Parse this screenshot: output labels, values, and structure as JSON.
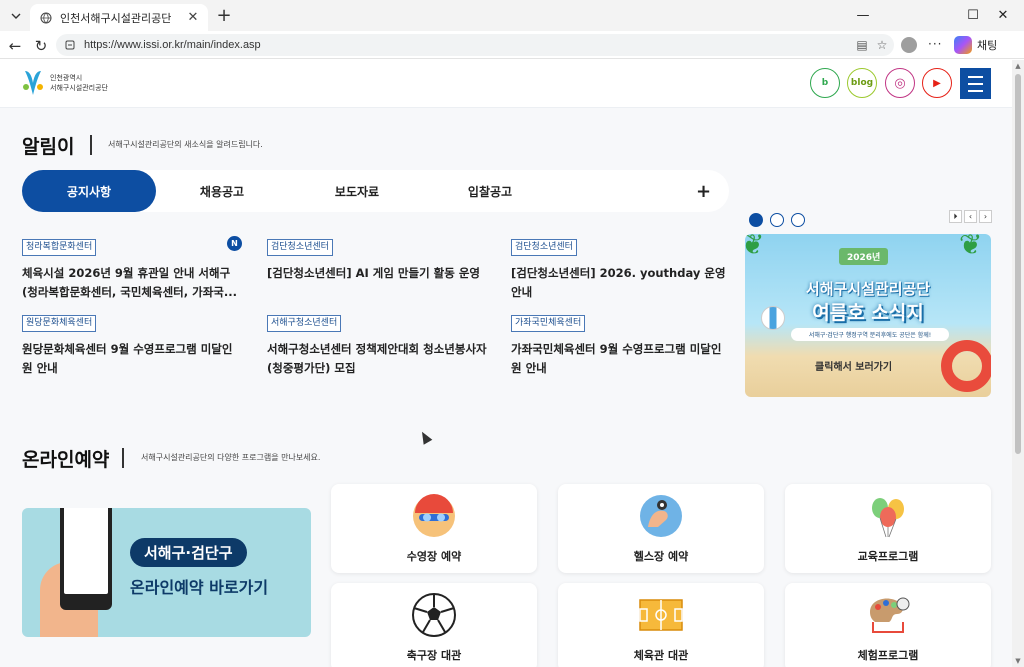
{
  "browser": {
    "tab_title": "인천서해구시설관리공단",
    "url": "https://www.issi.or.kr/main/index.asp",
    "copilot_label": "채팅"
  },
  "header": {
    "logo_line1": "인천광역시",
    "logo_line2": "서해구시설관리공단",
    "sns": [
      {
        "name": "band",
        "label": "b",
        "color": "#2fa84f"
      },
      {
        "name": "blog",
        "label": "blog",
        "color": "#9cc92e"
      },
      {
        "name": "instagram",
        "label": "◎",
        "color": "#c13584"
      },
      {
        "name": "youtube",
        "label": "▶",
        "color": "#e62117"
      }
    ]
  },
  "notice": {
    "title": "알림이",
    "desc": "서해구시설관리공단의 새소식을 알려드립니다.",
    "tabs": [
      "공지사항",
      "채용공고",
      "보도자료",
      "입찰공고"
    ],
    "more": "+",
    "items": [
      {
        "badge": "청라복합문화센터",
        "title": "체육시설 2026년 9월 휴관일 안내 서해구 (청라복합문화센터, 국민체육센터, 가좌국...",
        "new": "N"
      },
      {
        "badge": "검단청소년센터",
        "title": "[검단청소년센터] AI 게임 만들기 활동 운영"
      },
      {
        "badge": "검단청소년센터",
        "title": "[검단청소년센터] 2026. youthday 운영안내"
      },
      {
        "badge": "원당문화체육센터",
        "title": "원당문화체육센터 9월 수영프로그램 미달인원 안내"
      },
      {
        "badge": "서해구청소년센터",
        "title": "서해구청소년센터 정책제안대회 청소년봉사자(청중평가단) 모집"
      },
      {
        "badge": "가좌국민체육센터",
        "title": "가좌국민체육센터 9월 수영프로그램 미달인원 안내"
      }
    ]
  },
  "banner": {
    "year": "2026년",
    "line1": "서해구시설관리공단",
    "line2": "여름호 소식지",
    "sub": "서해구·검단구 행정구역 분리후에도 공단은 함께!",
    "cta": "클릭해서 보러가기",
    "dots": 3,
    "active_dot": 0,
    "controls": [
      "⏵",
      "‹",
      "›"
    ]
  },
  "reservation": {
    "title": "온라인예약",
    "desc": "서해구시설관리공단의 다양한 프로그램을 만나보세요.",
    "banner_line1": "서해구·검단구",
    "banner_line2": "온라인예약 바로가기",
    "cards": [
      {
        "label": "수영장 예약",
        "icon": "swimmer-icon"
      },
      {
        "label": "헬스장 예약",
        "icon": "fitness-icon"
      },
      {
        "label": "교육프로그램",
        "icon": "balloons-icon"
      },
      {
        "label": "축구장 대관",
        "icon": "soccer-ball-icon"
      },
      {
        "label": "체육관 대관",
        "icon": "gym-court-icon"
      },
      {
        "label": "체험프로그램",
        "icon": "art-palette-icon"
      }
    ]
  }
}
